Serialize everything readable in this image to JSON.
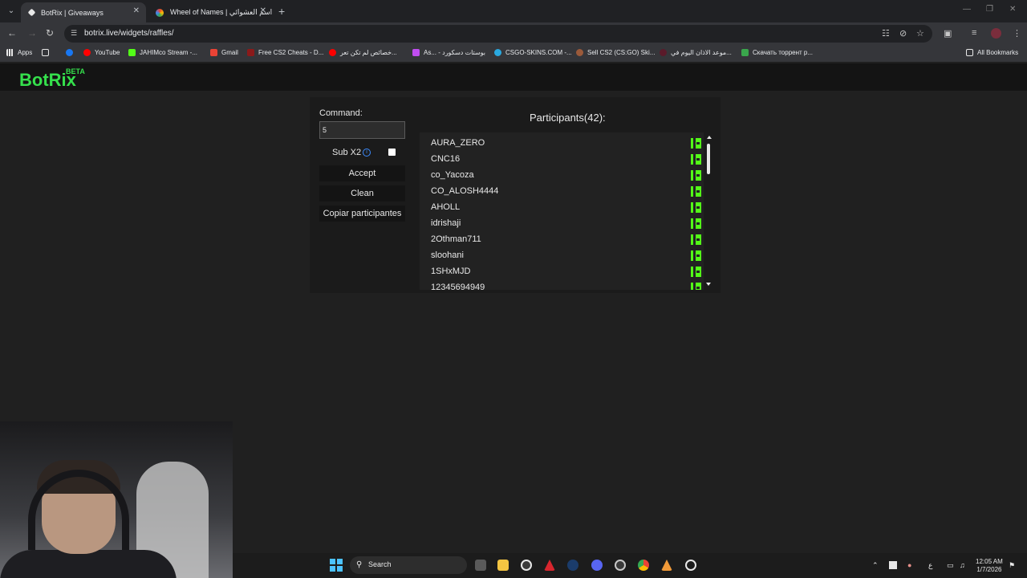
{
  "browser": {
    "tabs": [
      {
        "label": "BotRix | Giveaways",
        "active": true
      },
      {
        "label": "Wheel of Names | اسم العشوائي",
        "active": false
      }
    ],
    "url": "botrix.live/widgets/raffles/",
    "bookmarks": [
      "Apps",
      "YouTube",
      "JAHIMco Stream -...",
      "Gmail",
      "Free CS2 Cheats - D...",
      "خصائص لم تكن تعر...",
      "As... - بوستات دسكورد",
      "CSGO-SKINS.COM -...",
      "Sell CS2 (CS:GO) Ski...",
      "موعد الاذان اليوم في...",
      "Скачать торрент р...",
      "All Bookmarks"
    ]
  },
  "app": {
    "logo": "BotRix",
    "beta": "BETA"
  },
  "raffle": {
    "command_label": "Command:",
    "command_value": "5",
    "subx2_label": "Sub X2",
    "subx2_checked": false,
    "accept_label": "Accept",
    "clean_label": "Clean",
    "copy_label": "Copiar participantes",
    "participants_title": "Participants(42):",
    "participants": [
      "AURA_ZERO",
      "CNC16",
      "co_Yacoza",
      "CO_ALOSH4444",
      "AHOLL",
      "idrishaji",
      "2Othman711",
      "sloohani",
      "1SHxMJD",
      "12345694949"
    ],
    "platform_icon": "kick-icon",
    "platform_color": "#53fc18"
  },
  "taskbar": {
    "search_label": "Search",
    "lang": "ع",
    "time": "12:05 AM",
    "date": "1/7/2026"
  }
}
